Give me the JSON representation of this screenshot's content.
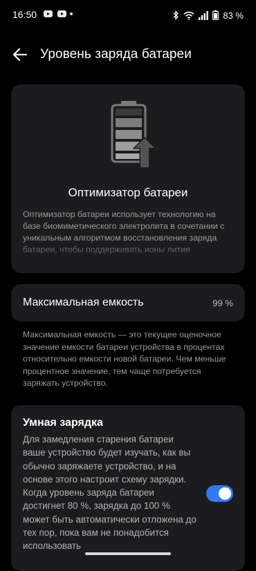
{
  "status_bar": {
    "time": "16:50",
    "battery_percent": "83 %",
    "icons": [
      "youtube-icon",
      "youtube-icon",
      "dot-icon",
      "bluetooth-icon",
      "wifi-icon",
      "signal-icon",
      "battery-icon"
    ]
  },
  "header": {
    "title": "Уровень заряда батареи",
    "back_icon": "arrow-left-icon"
  },
  "optimizer": {
    "icon": "battery-upgrade-icon",
    "title": "Оптимизатор батареи",
    "description": "Оптимизатор батареи использует технологию на базе биомиметического электролита в сочетании с уникальным алгоритмом восстановления заряда батареи, чтобы поддерживать ионы лития"
  },
  "capacity": {
    "label": "Максимальная емкость",
    "value": "99 %",
    "description": "Максимальная емкость — это текущее оценочное значение емкости батареи устройства в процентах относительно емкости новой батареи. Чем меньше процентное значение, тем чаще потребуется заряжать устройство."
  },
  "smart_charging": {
    "title": "Умная зарядка",
    "description": "Для замедления старения батареи ваше устройство будет изучать, как вы обычно заряжаете устройство, и на основе этого настроит схему зарядки. Когда уровень заряда батареи достигнет 80 %, зарядка до 100 % может быть автоматически отложена до тех пор, пока вам не понадобится использовать",
    "enabled": true
  },
  "colors": {
    "background": "#000000",
    "card": "#1c1c1e",
    "accent": "#2f7bf6",
    "secondary_text": "#9a9a9a"
  }
}
